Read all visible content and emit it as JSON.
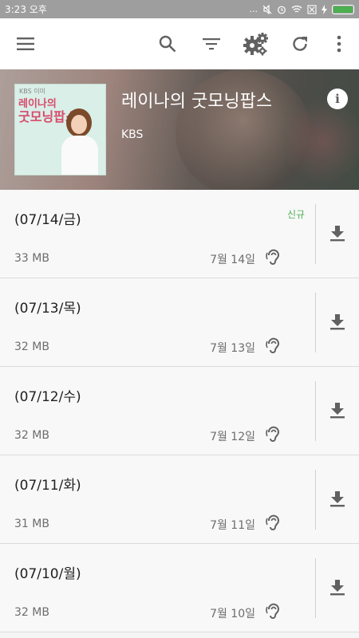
{
  "status_bar": {
    "time": "3:23 오후",
    "dots": "..."
  },
  "toolbar": {
    "icons": [
      "menu-icon",
      "search-icon",
      "filter-icon",
      "settings-icon",
      "refresh-icon",
      "more-vert-icon"
    ]
  },
  "podcast": {
    "title": "레이나의 굿모닝팝스",
    "author": "KBS",
    "info_symbol": "i",
    "album_art": {
      "brand": "KBS 이미",
      "logo_line1": "레이나의",
      "logo_line2": "굿모닝팝스"
    }
  },
  "episodes": [
    {
      "title": "(07/14/금)",
      "size": "33 MB",
      "date": "7월 14일",
      "badge": "신규"
    },
    {
      "title": "(07/13/목)",
      "size": "32 MB",
      "date": "7월 13일",
      "badge": ""
    },
    {
      "title": "(07/12/수)",
      "size": "32 MB",
      "date": "7월 12일",
      "badge": ""
    },
    {
      "title": "(07/11/화)",
      "size": "31 MB",
      "date": "7월 11일",
      "badge": ""
    },
    {
      "title": "(07/10/월)",
      "size": "32 MB",
      "date": "7월 10일",
      "badge": ""
    }
  ],
  "colors": {
    "accent_green": "#4caf50",
    "status_bar": "#9e9e9e",
    "icon_gray": "#616161"
  }
}
